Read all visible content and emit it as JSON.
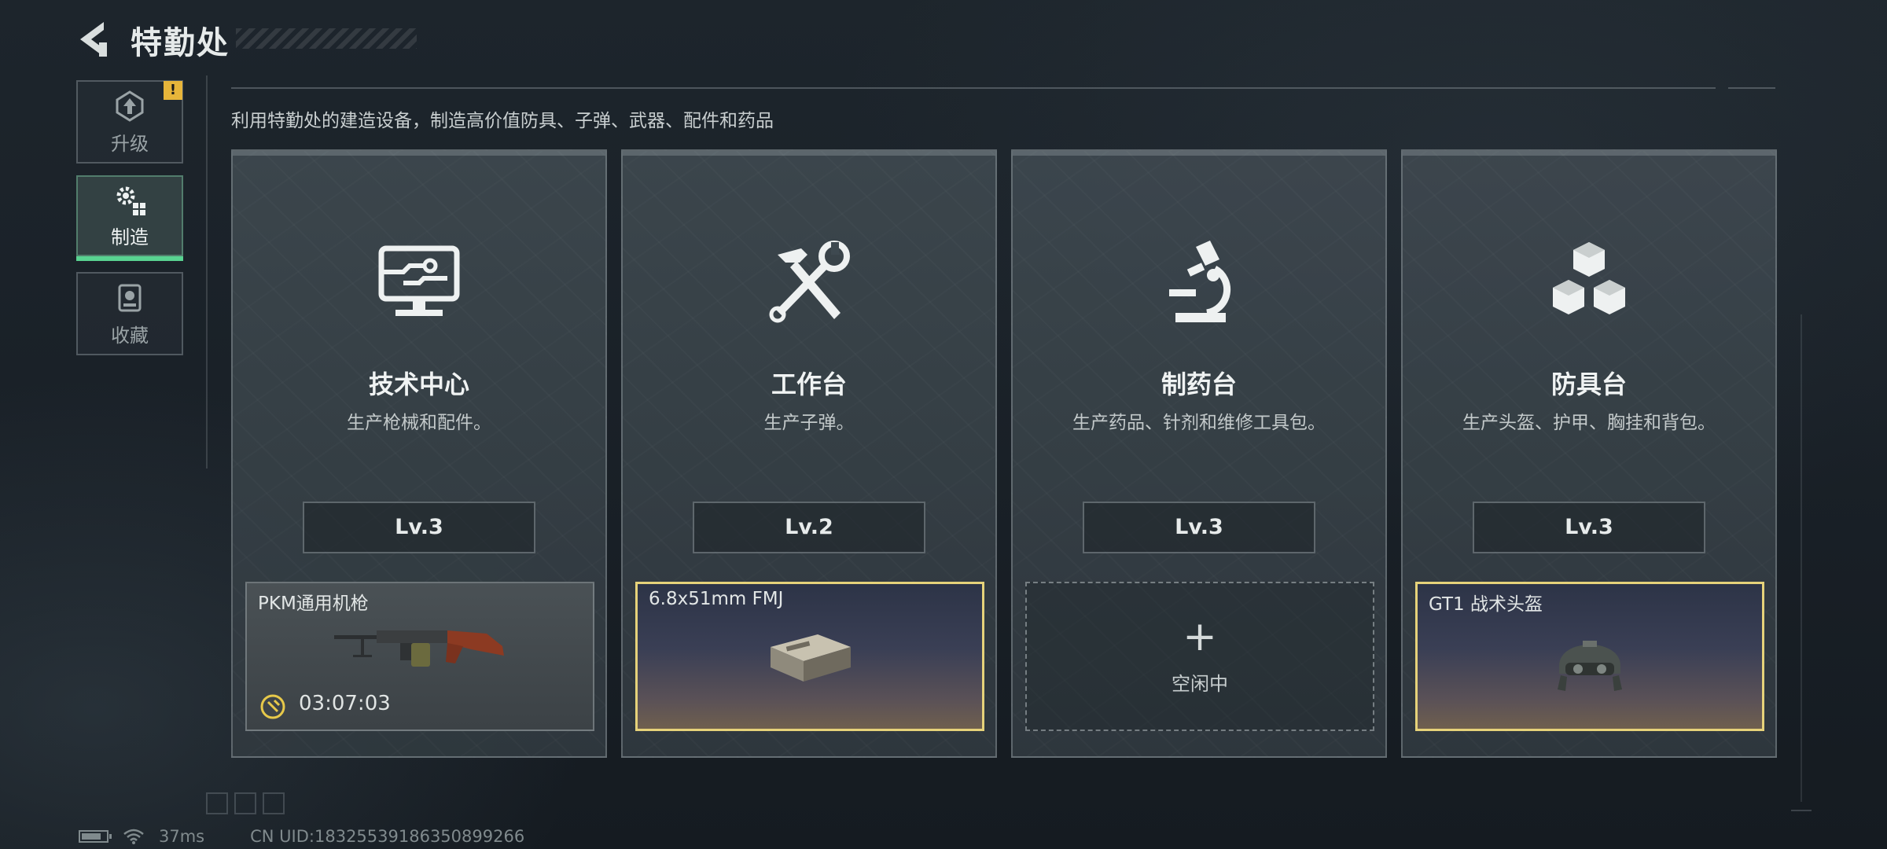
{
  "header": {
    "title": "特勤处",
    "back_icon": "back-arrow-icon"
  },
  "sidebar": {
    "items": [
      {
        "label": "升级",
        "icon": "upgrade-icon",
        "badge": "!",
        "active": false
      },
      {
        "label": "制造",
        "icon": "gear-manufacture-icon",
        "active": true
      },
      {
        "label": "收藏",
        "icon": "collection-icon",
        "active": false
      }
    ],
    "accent_color": "#59d391"
  },
  "description": "利用特勤处的建造设备，制造高价值防具、子弹、武器、配件和药品",
  "stations": [
    {
      "title": "技术中心",
      "subtitle": "生产枪械和配件。",
      "level": "Lv.3",
      "icon": "computer-terminal-icon",
      "slot": {
        "state": "in-progress",
        "item_name": "PKM通用机枪",
        "timer": "03:07:03",
        "item_icon": "machine-gun-icon"
      }
    },
    {
      "title": "工作台",
      "subtitle": "生产子弹。",
      "level": "Lv.2",
      "icon": "hammer-wrench-icon",
      "slot": {
        "state": "completed",
        "item_name": "6.8x51mm FMJ",
        "item_icon": "ammo-box-icon"
      }
    },
    {
      "title": "制药台",
      "subtitle": "生产药品、针剂和维修工具包。",
      "level": "Lv.3",
      "icon": "microscope-icon",
      "slot": {
        "state": "idle",
        "plus": "+",
        "idle_text": "空闲中"
      }
    },
    {
      "title": "防具台",
      "subtitle": "生产头盔、护甲、胸挂和背包。",
      "level": "Lv.3",
      "icon": "cubes-icon",
      "slot": {
        "state": "completed",
        "item_name": "GT1 战术头盔",
        "item_icon": "tactical-helmet-icon"
      }
    }
  ],
  "status": {
    "ping": "37ms",
    "uid": "CN UID:18325539186350899266"
  },
  "colors": {
    "gold_border": "#e6d27a",
    "badge": "#e7b53a"
  }
}
